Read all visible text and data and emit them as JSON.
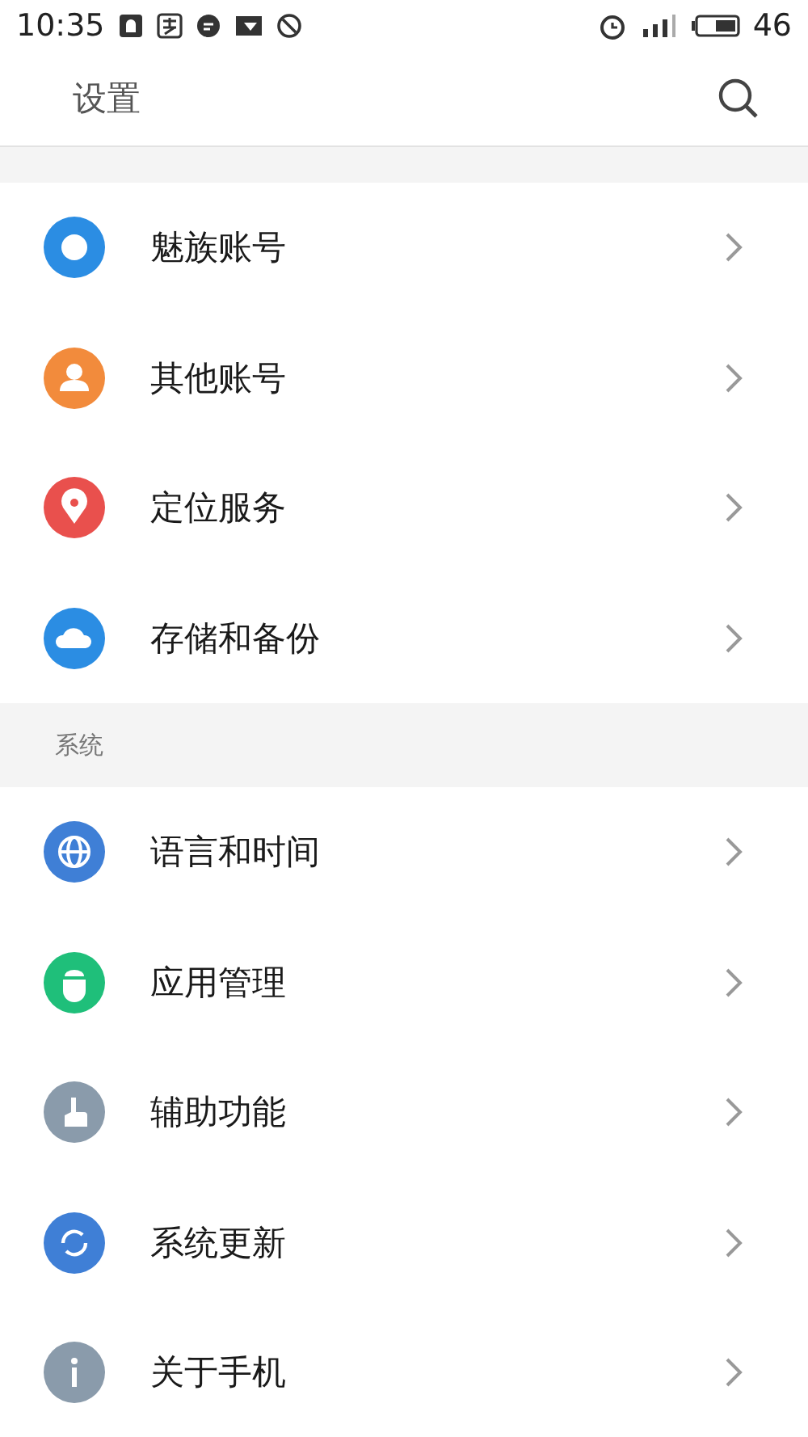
{
  "status_bar": {
    "time": "10:35",
    "battery": "46"
  },
  "header": {
    "title": "设置"
  },
  "sections": [
    {
      "items": [
        {
          "label": "魅族账号",
          "kind": "account",
          "color": "#2b8de3"
        },
        {
          "label": "其他账号",
          "kind": "person",
          "color": "#f28b3c"
        },
        {
          "label": "定位服务",
          "kind": "location",
          "color": "#e9504d"
        },
        {
          "label": "存储和备份",
          "kind": "cloud",
          "color": "#2b8de3"
        }
      ]
    },
    {
      "title": "系统",
      "items": [
        {
          "label": "语言和时间",
          "kind": "globe",
          "color": "#3f7fd6"
        },
        {
          "label": "应用管理",
          "kind": "android",
          "color": "#1fbf7a"
        },
        {
          "label": "辅助功能",
          "kind": "hand",
          "color": "#8a9bab"
        },
        {
          "label": "系统更新",
          "kind": "update",
          "color": "#3f7fd6"
        },
        {
          "label": "关于手机",
          "kind": "info",
          "color": "#8a9bab"
        }
      ]
    }
  ]
}
